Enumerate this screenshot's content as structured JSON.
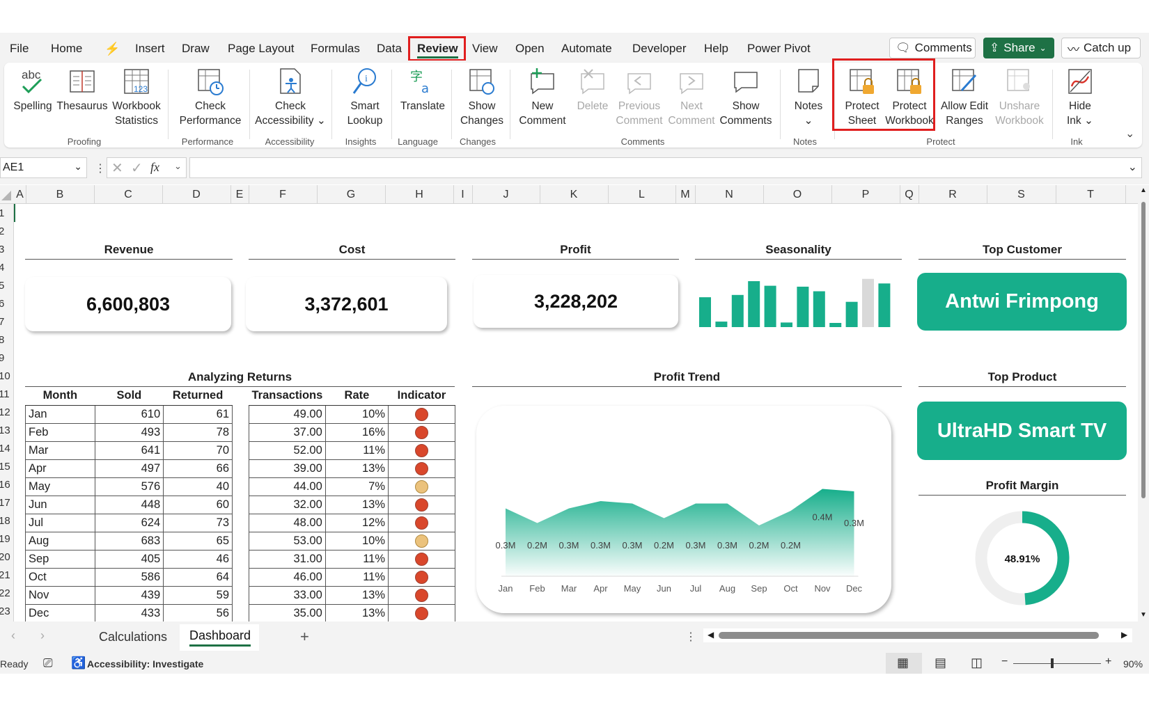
{
  "menu": {
    "items": [
      "File",
      "Home",
      "Insert",
      "Draw",
      "Page Layout",
      "Formulas",
      "Data",
      "Review",
      "View",
      "Open",
      "Automate",
      "Developer",
      "Help",
      "Power Pivot"
    ],
    "active": "Review",
    "comments_label": "Comments",
    "share_label": "Share",
    "catchup_label": "Catch up"
  },
  "ribbon": {
    "spelling_abc": "abc",
    "buttons": {
      "spelling": "Spelling",
      "thesaurus": "Thesaurus",
      "workbook_stats_1": "Workbook",
      "workbook_stats_2": "Statistics",
      "check_perf_1": "Check",
      "check_perf_2": "Performance",
      "check_access_1": "Check",
      "check_access_2": "Accessibility ⌄",
      "smart_lookup_1": "Smart",
      "smart_lookup_2": "Lookup",
      "translate": "Translate",
      "show_changes_1": "Show",
      "show_changes_2": "Changes",
      "new_comment_1": "New",
      "new_comment_2": "Comment",
      "delete": "Delete",
      "prev_comment_1": "Previous",
      "prev_comment_2": "Comment",
      "next_comment_1": "Next",
      "next_comment_2": "Comment",
      "show_comments_1": "Show",
      "show_comments_2": "Comments",
      "notes_1": "Notes",
      "notes_2": "⌄",
      "protect_sheet_1": "Protect",
      "protect_sheet_2": "Sheet",
      "protect_workbook_1": "Protect",
      "protect_workbook_2": "Workbook",
      "allow_edit_1": "Allow Edit",
      "allow_edit_2": "Ranges",
      "unshare_1": "Unshare",
      "unshare_2": "Workbook",
      "hide_ink_1": "Hide",
      "hide_ink_2": "Ink ⌄"
    },
    "groups": {
      "proofing": "Proofing",
      "performance": "Performance",
      "accessibility": "Accessibility",
      "insights": "Insights",
      "language": "Language",
      "changes": "Changes",
      "comments": "Comments",
      "notes": "Notes",
      "protect": "Protect",
      "ink": "Ink"
    }
  },
  "formula_bar": {
    "name_box": "AE1",
    "fx": "fx",
    "value": ""
  },
  "columns": [
    "A",
    "B",
    "C",
    "D",
    "E",
    "F",
    "G",
    "H",
    "I",
    "J",
    "K",
    "L",
    "M",
    "N",
    "O",
    "P",
    "Q",
    "R",
    "S",
    "T"
  ],
  "rows": [
    "1",
    "2",
    "3",
    "4",
    "5",
    "6",
    "7",
    "8",
    "9",
    "10",
    "11",
    "12",
    "13",
    "14",
    "15",
    "16",
    "17",
    "18",
    "19",
    "20",
    "21",
    "22",
    "23"
  ],
  "kpis": {
    "revenue_title": "Revenue",
    "revenue_value": "6,600,803",
    "cost_title": "Cost",
    "cost_value": "3,372,601",
    "profit_title": "Profit",
    "profit_value": "3,228,202",
    "seasonality_title": "Seasonality",
    "top_customer_title": "Top Customer",
    "top_customer_value": "Antwi Frimpong",
    "top_product_title": "Top Product",
    "top_product_value": "UltraHD Smart TV",
    "profit_margin_title": "Profit Margin",
    "profit_margin_value": "48.91%"
  },
  "colors": {
    "accent": "#17ae8b",
    "excel_green": "#1e7145",
    "red_dot": "#d9472b",
    "amber_dot": "#ebc27c",
    "gray_bar": "#d9d9d9"
  },
  "returns_table": {
    "title": "Analyzing Returns",
    "headers": [
      "Month",
      "Sold",
      "Returned",
      "Transactions",
      "Rate",
      "Indicator"
    ],
    "rows": [
      {
        "month": "Jan",
        "sold": "610",
        "returned": "61",
        "transactions": "49.00",
        "rate": "10%",
        "indicator": "red"
      },
      {
        "month": "Feb",
        "sold": "493",
        "returned": "78",
        "transactions": "37.00",
        "rate": "16%",
        "indicator": "red"
      },
      {
        "month": "Mar",
        "sold": "641",
        "returned": "70",
        "transactions": "52.00",
        "rate": "11%",
        "indicator": "red"
      },
      {
        "month": "Apr",
        "sold": "497",
        "returned": "66",
        "transactions": "39.00",
        "rate": "13%",
        "indicator": "red"
      },
      {
        "month": "May",
        "sold": "576",
        "returned": "40",
        "transactions": "44.00",
        "rate": "7%",
        "indicator": "amber"
      },
      {
        "month": "Jun",
        "sold": "448",
        "returned": "60",
        "transactions": "32.00",
        "rate": "13%",
        "indicator": "red"
      },
      {
        "month": "Jul",
        "sold": "624",
        "returned": "73",
        "transactions": "48.00",
        "rate": "12%",
        "indicator": "red"
      },
      {
        "month": "Aug",
        "sold": "683",
        "returned": "65",
        "transactions": "53.00",
        "rate": "10%",
        "indicator": "amber"
      },
      {
        "month": "Sep",
        "sold": "405",
        "returned": "46",
        "transactions": "31.00",
        "rate": "11%",
        "indicator": "red"
      },
      {
        "month": "Oct",
        "sold": "586",
        "returned": "64",
        "transactions": "46.00",
        "rate": "11%",
        "indicator": "red"
      },
      {
        "month": "Nov",
        "sold": "439",
        "returned": "59",
        "transactions": "33.00",
        "rate": "13%",
        "indicator": "red"
      },
      {
        "month": "Dec",
        "sold": "433",
        "returned": "56",
        "transactions": "35.00",
        "rate": "13%",
        "indicator": "red"
      }
    ]
  },
  "chart_data": [
    {
      "type": "area",
      "title": "Profit Trend",
      "categories": [
        "Jan",
        "Feb",
        "Mar",
        "Apr",
        "May",
        "Jun",
        "Jul",
        "Aug",
        "Sep",
        "Oct",
        "Nov",
        "Dec"
      ],
      "values": [
        0.28,
        0.22,
        0.28,
        0.31,
        0.3,
        0.24,
        0.3,
        0.3,
        0.21,
        0.27,
        0.36,
        0.35
      ],
      "data_labels": [
        "0.3M",
        "0.2M",
        "0.3M",
        "0.3M",
        "0.3M",
        "0.2M",
        "0.3M",
        "0.3M",
        "0.2M",
        "0.2M",
        "0.4M",
        "0.3M"
      ],
      "xlabel": "",
      "ylabel": "",
      "grid": false
    },
    {
      "type": "bar",
      "title": "Seasonality",
      "values": [
        0.65,
        0.12,
        0.7,
        1.0,
        0.9,
        0.1,
        0.88,
        0.78,
        0.08,
        0.55,
        1.05,
        0.95
      ],
      "colors": [
        "#17ae8b",
        "#17ae8b",
        "#17ae8b",
        "#17ae8b",
        "#17ae8b",
        "#17ae8b",
        "#17ae8b",
        "#17ae8b",
        "#17ae8b",
        "#17ae8b",
        "#d9d9d9",
        "#17ae8b"
      ],
      "axis": false
    },
    {
      "type": "pie",
      "title": "Profit Margin",
      "values": [
        48.91,
        51.09
      ],
      "center_label": "48.91%"
    }
  ],
  "sheet_tabs": [
    "Calculations",
    "Dashboard"
  ],
  "active_tab": "Dashboard",
  "status": {
    "ready": "Ready",
    "accessibility": "Accessibility: Investigate",
    "zoom": "90%"
  }
}
